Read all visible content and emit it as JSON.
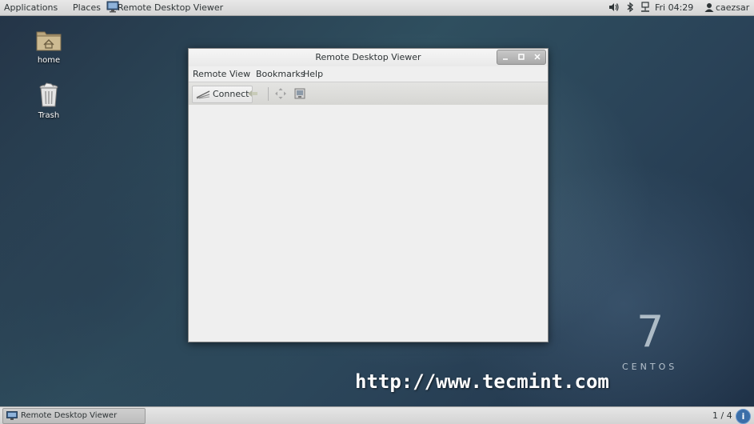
{
  "topbar": {
    "applications_label": "Applications",
    "places_label": "Places",
    "active_app_label": "Remote Desktop Viewer",
    "clock": "Fri 04:29",
    "user": "caezsar",
    "icons": [
      "volume-icon",
      "bluetooth-icon",
      "network-icon",
      "user-icon"
    ]
  },
  "desktop": {
    "icons": [
      {
        "label": "home",
        "icon": "home-folder-icon"
      },
      {
        "label": "Trash",
        "icon": "trash-icon"
      }
    ],
    "logo_number": "7",
    "logo_text": "CENTOS",
    "watermark": "http://www.tecmint.com"
  },
  "window": {
    "title": "Remote Desktop Viewer",
    "buttons": [
      "minimize",
      "maximize",
      "close"
    ],
    "menu": [
      "Remote",
      "View",
      "Bookmarks",
      "Help"
    ],
    "toolbar": {
      "connect_label": "Connect",
      "tools": [
        "disconnect-icon",
        "fullscreen-icon",
        "screenshot-icon"
      ]
    }
  },
  "bottombar": {
    "task_label": "Remote Desktop Viewer",
    "workspace": "1 / 4",
    "notification_symbol": "i"
  },
  "colors": {
    "panel": "#dcdcdc",
    "window_bg": "#efefef",
    "notification": "#3b6ea8"
  }
}
